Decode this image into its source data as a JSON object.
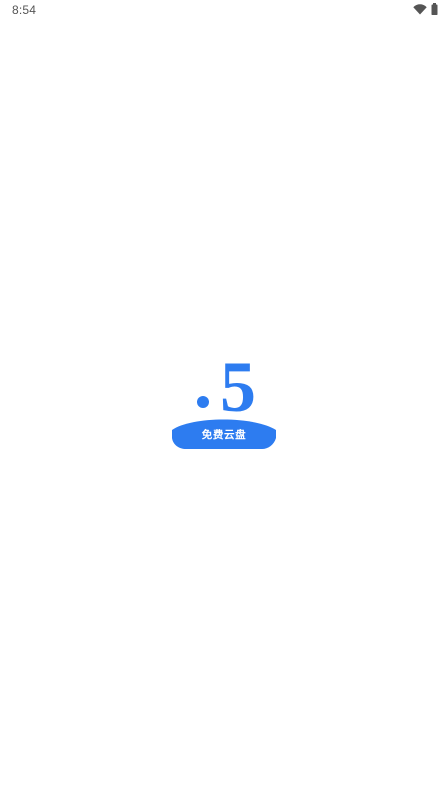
{
  "status_bar": {
    "time": "8:54",
    "icons": [
      "wifi-icon",
      "battery-icon"
    ]
  },
  "splash": {
    "logo_numeral": "5",
    "logo_text": "免费云盘",
    "brand_color": "#2d7cf0",
    "background": "#ffffff"
  }
}
